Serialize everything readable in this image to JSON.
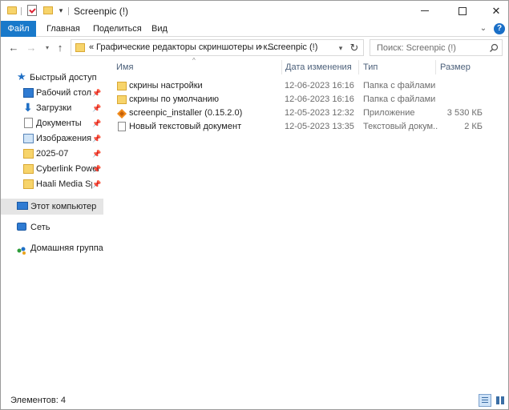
{
  "window": {
    "title": "Screenpic (!)"
  },
  "ribbon": {
    "tabs": [
      "Файл",
      "Главная",
      "Поделиться",
      "Вид"
    ],
    "help_label": "?"
  },
  "address": {
    "overflow": "«",
    "crumb1": "Графические редакторы скриншотеры и к...",
    "sep": "›",
    "crumb2": "Screenpic (!)"
  },
  "search": {
    "placeholder": "Поиск: Screenpic (!)"
  },
  "navpane": {
    "items": [
      {
        "label": "Быстрый доступ",
        "icon": "star-icon",
        "pinned": false
      },
      {
        "label": "Рабочий стол",
        "icon": "desktop-icon",
        "pinned": true
      },
      {
        "label": "Загрузки",
        "icon": "download-icon",
        "pinned": true
      },
      {
        "label": "Документы",
        "icon": "documents-icon",
        "pinned": true
      },
      {
        "label": "Изображения",
        "icon": "pictures-icon",
        "pinned": true
      },
      {
        "label": "2025-07",
        "icon": "folder-icon",
        "pinned": true
      },
      {
        "label": "Cyberlink Power",
        "icon": "folder-icon",
        "pinned": true
      },
      {
        "label": "Haali Media Split",
        "icon": "folder-icon",
        "pinned": true
      },
      {
        "label": "Этот компьютер",
        "icon": "computer-icon",
        "pinned": false
      },
      {
        "label": "Сеть",
        "icon": "network-icon",
        "pinned": false
      },
      {
        "label": "Домашняя группа",
        "icon": "homegroup-icon",
        "pinned": false
      }
    ]
  },
  "columns": {
    "name": "Имя",
    "date": "Дата изменения",
    "type": "Тип",
    "size": "Размер"
  },
  "files": [
    {
      "name": "скрины настройки",
      "date": "12-06-2023 16:16",
      "type": "Папка с файлами",
      "size": "",
      "icon": "folder-icon"
    },
    {
      "name": "скрины по умолчанию",
      "date": "12-06-2023 16:16",
      "type": "Папка с файлами",
      "size": "",
      "icon": "folder-icon"
    },
    {
      "name": "screenpic_installer (0.15.2.0)",
      "date": "12-05-2023 12:32",
      "type": "Приложение",
      "size": "3 530 КБ",
      "icon": "installer-icon"
    },
    {
      "name": "Новый текстовый документ",
      "date": "12-05-2023 13:35",
      "type": "Текстовый докум...",
      "size": "2 КБ",
      "icon": "text-file-icon"
    }
  ],
  "status": {
    "items_count": "Элементов: 4"
  },
  "colors": {
    "file_tab": "#1979ca",
    "selected_nav": "#e5e5e5",
    "folder": "#f7d46b"
  }
}
